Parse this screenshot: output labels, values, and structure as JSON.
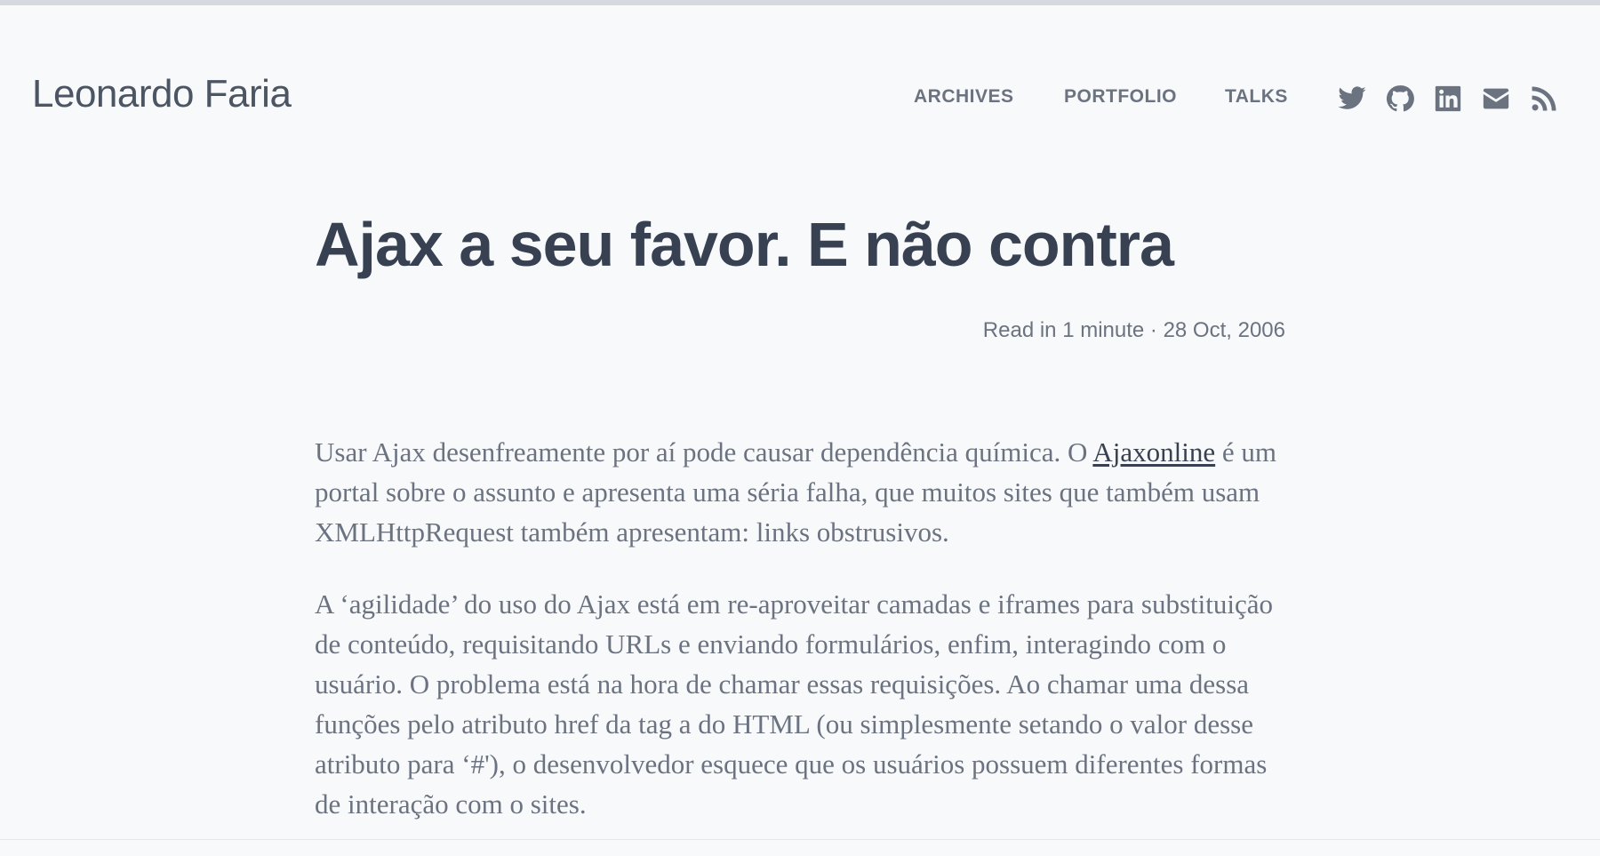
{
  "site": {
    "title": "Leonardo Faria"
  },
  "nav": {
    "items": [
      {
        "label": "ARCHIVES"
      },
      {
        "label": "PORTFOLIO"
      },
      {
        "label": "TALKS"
      }
    ]
  },
  "social": {
    "icons": [
      "twitter-icon",
      "github-icon",
      "linkedin-icon",
      "email-icon",
      "rss-icon"
    ]
  },
  "post": {
    "title": "Ajax a seu favor. E não contra",
    "meta": "Read in 1 minute · 28 Oct, 2006",
    "p1_before": "Usar Ajax desenfreamente por aí pode causar dependência química. O ",
    "p1_link": "Ajaxonline",
    "p1_after": " é um portal sobre o assunto e apresenta uma séria falha, que muitos sites que também usam XMLHttpRequest também apresentam: links obstrusivos.",
    "p2": "A ‘agilidade’ do uso do Ajax está em re-aproveitar camadas e iframes para substituição de conteúdo, requisitando URLs e enviando formulários, enfim, interagindo com o usuário. O problema está na hora de chamar essas requisições. Ao chamar uma dessa funções pelo atributo href da tag a do HTML (ou simplesmente setando o valor desse atributo para ‘#'), o desenvolvedor esquece que os usuários possuem diferentes formas de interação com o sites."
  },
  "colors": {
    "background": "#f8f9fb",
    "heading": "#374151",
    "muted": "#6b7280",
    "top_bar": "#d6d9e0"
  }
}
